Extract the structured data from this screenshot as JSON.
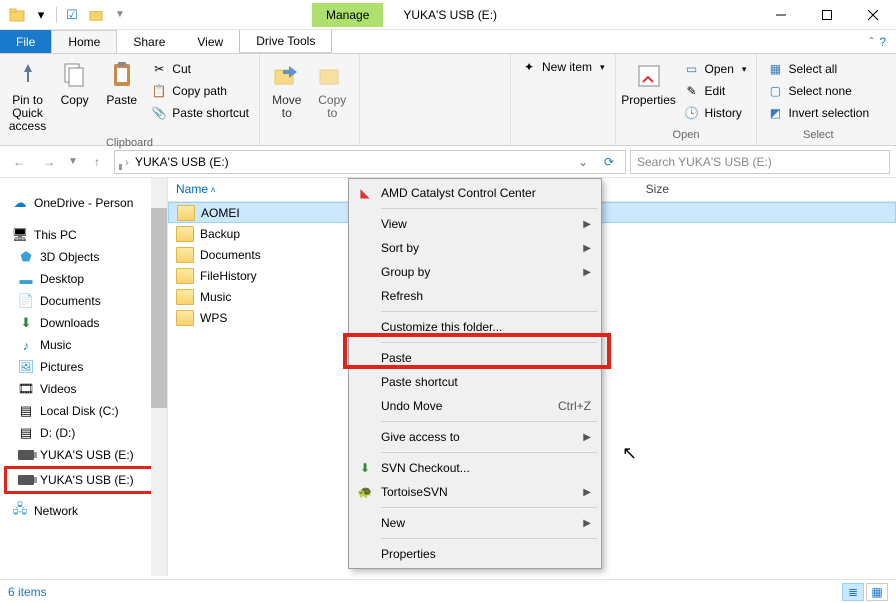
{
  "window": {
    "title": "YUKA'S USB (E:)",
    "manage_tab": "Manage"
  },
  "tabs": {
    "file": "File",
    "home": "Home",
    "share": "Share",
    "view": "View",
    "drivetools": "Drive Tools"
  },
  "ribbon": {
    "pin": "Pin to Quick access",
    "copy": "Copy",
    "paste": "Paste",
    "cut": "Cut",
    "copypath": "Copy path",
    "pasteshortcut": "Paste shortcut",
    "group_clipboard": "Clipboard",
    "moveto": "Move to",
    "copyto": "Copy to",
    "newitem": "New item",
    "properties": "Properties",
    "open": "Open",
    "edit": "Edit",
    "history": "History",
    "group_open": "Open",
    "selectall": "Select all",
    "selectnone": "Select none",
    "invert": "Invert selection",
    "group_select": "Select"
  },
  "address": {
    "path": "YUKA'S USB (E:)",
    "search_placeholder": "Search YUKA'S USB (E:)"
  },
  "tree": {
    "onedrive": "OneDrive - Person",
    "thispc": "This PC",
    "items": [
      {
        "label": "3D Objects"
      },
      {
        "label": "Desktop"
      },
      {
        "label": "Documents"
      },
      {
        "label": "Downloads"
      },
      {
        "label": "Music"
      },
      {
        "label": "Pictures"
      },
      {
        "label": "Videos"
      },
      {
        "label": "Local Disk (C:)"
      },
      {
        "label": "D: (D:)"
      },
      {
        "label": "YUKA'S USB (E:)"
      },
      {
        "label": "YUKA'S USB (E:)"
      }
    ],
    "network": "Network"
  },
  "columns": {
    "name": "Name",
    "date": "",
    "type": "",
    "size": "Size"
  },
  "rows": [
    {
      "name": "AOMEI",
      "type": "folder"
    },
    {
      "name": "Backup",
      "type": "folder"
    },
    {
      "name": "Documents",
      "type": "folder"
    },
    {
      "name": "FileHistory",
      "type": "folder"
    },
    {
      "name": "Music",
      "type": "folder"
    },
    {
      "name": "WPS",
      "type": "folder"
    }
  ],
  "context": {
    "amd": "AMD Catalyst Control Center",
    "view": "View",
    "sortby": "Sort by",
    "groupby": "Group by",
    "refresh": "Refresh",
    "customize": "Customize this folder...",
    "paste": "Paste",
    "pasteshortcut": "Paste shortcut",
    "undo": "Undo Move",
    "undo_short": "Ctrl+Z",
    "giveaccess": "Give access to",
    "svn": "SVN Checkout...",
    "tortoise": "TortoiseSVN",
    "new": "New",
    "properties": "Properties"
  },
  "status": {
    "items": "6 items"
  }
}
